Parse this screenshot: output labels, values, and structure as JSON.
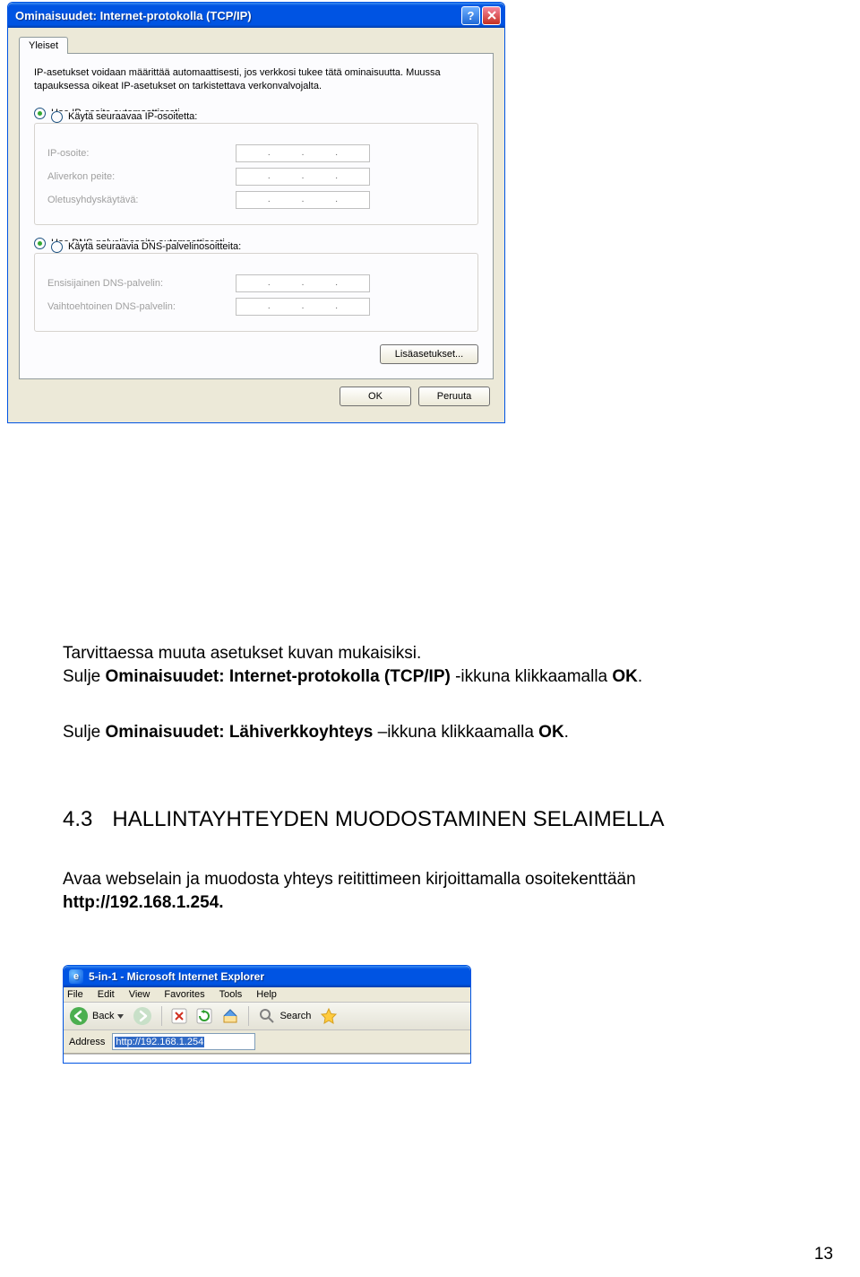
{
  "dialog": {
    "title": "Ominaisuudet: Internet-protokolla (TCP/IP)",
    "tab": "Yleiset",
    "explain": "IP-asetukset voidaan määrittää automaattisesti, jos verkkosi tukee tätä ominaisuutta. Muussa tapauksessa oikeat IP-asetukset on tarkistettava verkonvalvojalta.",
    "radio_ip_auto": "Hae IP-osoite automaattisesti",
    "radio_ip_manual": "Käytä seuraavaa IP-osoitetta:",
    "field_ip": "IP-osoite:",
    "field_mask": "Aliverkon peite:",
    "field_gw": "Oletusyhdyskäytävä:",
    "radio_dns_auto": "Hae DNS-palvelinosoite automaattisesti",
    "radio_dns_manual": "Käytä seuraavia DNS-palvelinosoitteita:",
    "field_dns1": "Ensisijainen DNS-palvelin:",
    "field_dns2": "Vaihtoehtoinen DNS-palvelin:",
    "btn_advanced": "Lisäasetukset...",
    "btn_ok": "OK",
    "btn_cancel": "Peruuta"
  },
  "doc": {
    "line1_pre": "Tarvittaessa muuta asetukset kuvan mukaisiksi.",
    "line2_pre": "Sulje ",
    "line2_bold": "Ominaisuudet: Internet-protokolla (TCP/IP)",
    "line2_mid": " -ikkuna klikkaamalla ",
    "line2_ok": "OK",
    "line2_end": ".",
    "line3_pre": "Sulje ",
    "line3_bold": "Ominaisuudet: Lähiverkkoyhteys",
    "line3_mid": " –ikkuna klikkaamalla ",
    "line3_ok": "OK",
    "line3_end": ".",
    "heading_num": "4.3",
    "heading_text": "HALLINTAYHTEYDEN MUODOSTAMINEN SELAIMELLA",
    "line4": "Avaa webselain ja muodosta yhteys reitittimeen kirjoittamalla osoitekenttään",
    "line5": "http://192.168.1.254.",
    "pagenum": "13"
  },
  "ie": {
    "title": "5-in-1 - Microsoft Internet Explorer",
    "menu": [
      "File",
      "Edit",
      "View",
      "Favorites",
      "Tools",
      "Help"
    ],
    "back": "Back",
    "search": "Search",
    "addr_label": "Address",
    "addr_value": "http://192.168.1.254"
  }
}
